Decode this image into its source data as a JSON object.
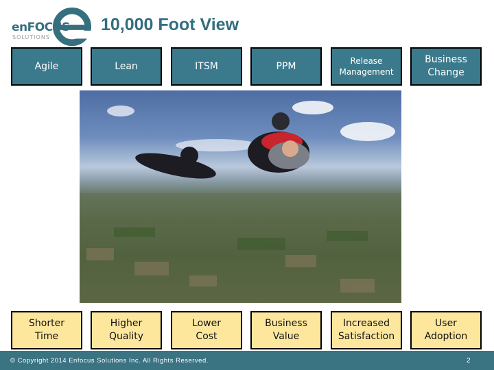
{
  "logo": {
    "word": "enFOCUS",
    "sub": "SOLUTIONS",
    "brand_color": "#36707f"
  },
  "slide": {
    "title": "10,000 Foot View"
  },
  "top_boxes": [
    {
      "line1": "Agile",
      "line2": ""
    },
    {
      "line1": "Lean",
      "line2": ""
    },
    {
      "line1": "ITSM",
      "line2": ""
    },
    {
      "line1": "PPM",
      "line2": ""
    },
    {
      "line1": "Release",
      "line2": "Management"
    },
    {
      "line1": "Business",
      "line2": "Change"
    }
  ],
  "bottom_boxes": [
    {
      "line1": "Shorter",
      "line2": "Time"
    },
    {
      "line1": "Higher",
      "line2": "Quality"
    },
    {
      "line1": "Lower",
      "line2": "Cost"
    },
    {
      "line1": "Business",
      "line2": "Value"
    },
    {
      "line1": "Increased",
      "line2": "Satisfaction"
    },
    {
      "line1": "User",
      "line2": "Adoption"
    }
  ],
  "photo": {
    "description": "tandem skydivers in freefall above farmland"
  },
  "footer": {
    "copyright": "© Copyright 2014 Enfocus Solutions Inc. All Rights Reserved.",
    "page_number": "2"
  },
  "colors": {
    "top_box_fill": "#3b7a8c",
    "bottom_box_fill": "#fde79d",
    "footer_bg": "#3a7382",
    "title": "#326e7f"
  }
}
